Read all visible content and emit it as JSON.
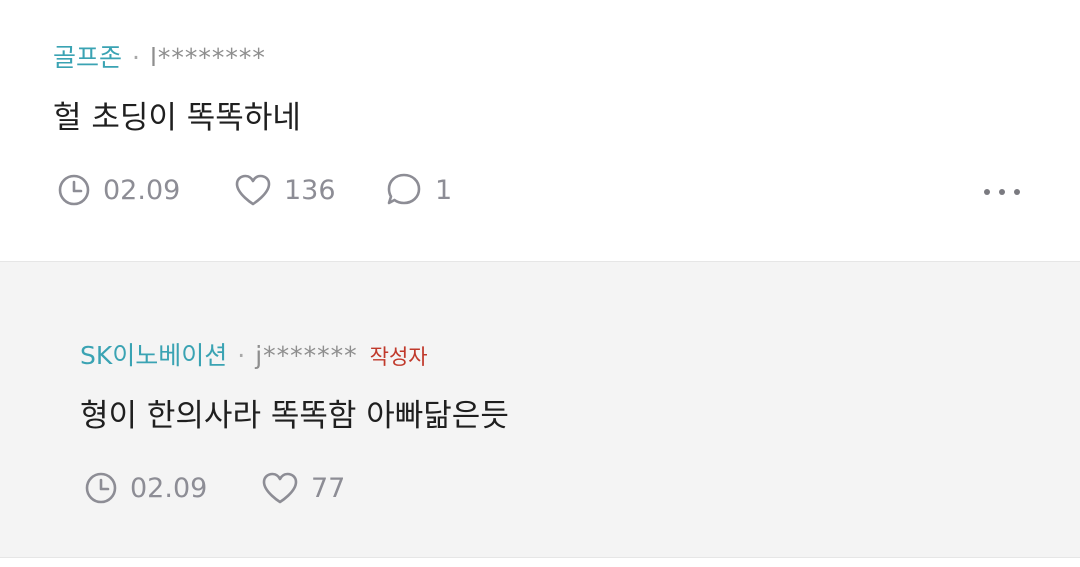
{
  "comments": [
    {
      "company": "골프존",
      "separator": "·",
      "user": "l********",
      "text": "헐 초딩이 똑똑하네",
      "date": "02.09",
      "likes": "136",
      "replies": "1"
    },
    {
      "company": "SK이노베이션",
      "separator": "·",
      "user": "j*******",
      "author_tag": "작성자",
      "text": "형이 한의사라 똑똑함 아빠닮은듯",
      "date": "02.09",
      "likes": "77"
    }
  ],
  "colors": {
    "company": "#3aa3b3",
    "author_tag": "#c0392b",
    "meta": "#8d8d95",
    "reply_background": "#f4f4f4"
  },
  "icons": {
    "date": "clock-icon",
    "likes": "heart-icon",
    "replies": "comment-bubble-icon",
    "menu": "more-options-icon"
  }
}
